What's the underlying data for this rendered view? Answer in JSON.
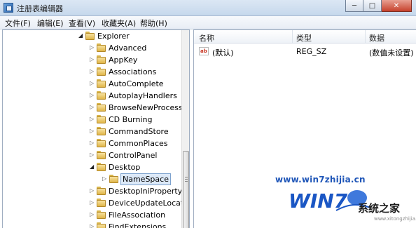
{
  "window": {
    "title": "注册表编辑器",
    "buttons": {
      "minimize": "─",
      "maximize": "□",
      "close": "✕"
    }
  },
  "menu": [
    "文件(F)",
    "编辑(E)",
    "查看(V)",
    "收藏夹(A)",
    "帮助(H)"
  ],
  "tree": {
    "parent": "Explorer",
    "items": [
      {
        "label": "Advanced"
      },
      {
        "label": "AppKey"
      },
      {
        "label": "Associations"
      },
      {
        "label": "AutoComplete"
      },
      {
        "label": "AutoplayHandlers"
      },
      {
        "label": "BrowseNewProcess"
      },
      {
        "label": "CD Burning"
      },
      {
        "label": "CommandStore"
      },
      {
        "label": "CommonPlaces"
      },
      {
        "label": "ControlPanel"
      },
      {
        "label": "Desktop"
      },
      {
        "label": "NameSpace",
        "selected": true
      },
      {
        "label": "DesktopIniPropertyM"
      },
      {
        "label": "DeviceUpdateLocatic"
      },
      {
        "label": "FileAssociation"
      },
      {
        "label": "FindExtensions"
      }
    ]
  },
  "values_pane": {
    "columns": {
      "name": "名称",
      "type": "类型",
      "data": "数据"
    },
    "rows": [
      {
        "icon": "ab",
        "name": "(默认)",
        "type": "REG_SZ",
        "data": "(数值未设置)"
      }
    ]
  },
  "watermark": {
    "url": "www.win7zhijia.cn",
    "logo_text": "WIN7",
    "site": "系统之家",
    "small": "www.xitongzhijia.net"
  }
}
